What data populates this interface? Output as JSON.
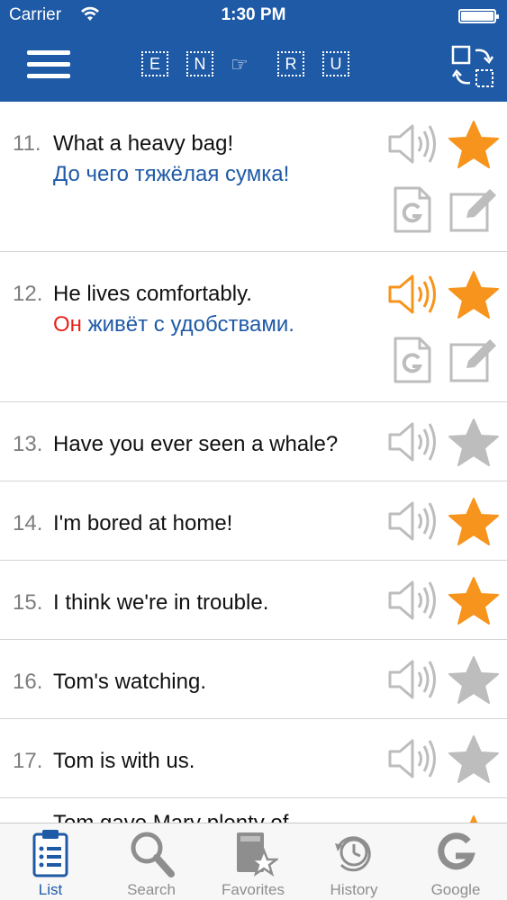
{
  "status_bar": {
    "carrier": "Carrier",
    "time": "1:30 PM"
  },
  "header": {
    "languages": [
      "E",
      "N",
      "R",
      "U"
    ],
    "arrow": "☞"
  },
  "phrases": [
    {
      "num": "11.",
      "en": "What a heavy bag!",
      "ru": "До чего тяжёлая сумка!",
      "ru_highlight": "",
      "favorite": true,
      "speaker_active": false,
      "expanded": true
    },
    {
      "num": "12.",
      "en": "He lives comfortably.",
      "ru_highlight": "Он",
      "ru": " живёт с удобствами.",
      "favorite": true,
      "speaker_active": true,
      "expanded": true
    },
    {
      "num": "13.",
      "en": "Have you ever seen a whale?",
      "favorite": false,
      "speaker_active": false,
      "expanded": false
    },
    {
      "num": "14.",
      "en": "I'm bored at home!",
      "favorite": true,
      "speaker_active": false,
      "expanded": false
    },
    {
      "num": "15.",
      "en": "I think we're in trouble.",
      "favorite": true,
      "speaker_active": false,
      "expanded": false
    },
    {
      "num": "16.",
      "en": "Tom's watching.",
      "favorite": false,
      "speaker_active": false,
      "expanded": false
    },
    {
      "num": "17.",
      "en": "Tom is with us.",
      "favorite": false,
      "speaker_active": false,
      "expanded": false
    }
  ],
  "partial_row": {
    "en": "Tom gave Mary plenty of"
  },
  "colors": {
    "brand": "#1f5aa6",
    "star_on": "#f7941d",
    "star_off": "#bdbdbd",
    "speaker_active": "#f7941d",
    "icon_gray": "#bdbdbd",
    "highlight": "#e8231b"
  },
  "tabs": [
    {
      "label": "List",
      "icon": "clipboard-list-icon",
      "active": true
    },
    {
      "label": "Search",
      "icon": "magnifier-icon",
      "active": false
    },
    {
      "label": "Favorites",
      "icon": "book-star-icon",
      "active": false
    },
    {
      "label": "History",
      "icon": "clock-icon",
      "active": false
    },
    {
      "label": "Google",
      "icon": "google-g-icon",
      "active": false
    }
  ]
}
